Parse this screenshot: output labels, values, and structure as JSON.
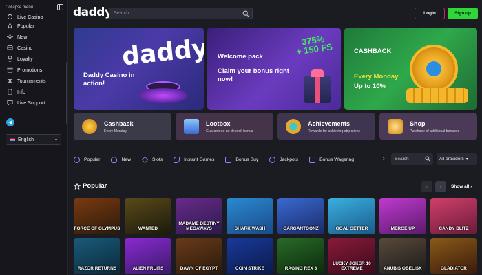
{
  "sidebar": {
    "collapse_label": "Collapse menu",
    "items": [
      {
        "label": "Live Casino"
      },
      {
        "label": "Popular"
      },
      {
        "label": "New"
      },
      {
        "label": "Casino"
      },
      {
        "label": "Loyalty"
      },
      {
        "label": "Promotions"
      },
      {
        "label": "Tournaments"
      },
      {
        "label": "Info"
      },
      {
        "label": "Live Support"
      }
    ],
    "language": "English"
  },
  "header": {
    "logo": "daddy",
    "search_placeholder": "Search...",
    "login_label": "Login",
    "signup_label": "Sign up"
  },
  "banners": {
    "b1": {
      "text": "Daddy Casino in action!",
      "art_text": "daddy"
    },
    "b2": {
      "title": "Welcome pack",
      "subtitle": "Claim your bonus right now!",
      "badge_pct": "375%",
      "badge_fs": "+ 150 FS"
    },
    "b3": {
      "title": "CASHBACK",
      "day": "Every Monday",
      "amount": "Up to 10%"
    }
  },
  "tiles": [
    {
      "title": "Cashback",
      "subtitle": "Every Monday",
      "color": "#f0a11f"
    },
    {
      "title": "Lootbox",
      "subtitle": "Guaranteed no deposit bonus",
      "color": "#5aa8ff"
    },
    {
      "title": "Achievements",
      "subtitle": "Rewards for achieving objectives",
      "color": "#e8a82a"
    },
    {
      "title": "Shop",
      "subtitle": "Purchase of additional bonuses",
      "color": "#f5b52a"
    }
  ],
  "categories": [
    {
      "label": "Popular",
      "color": "#a07bff"
    },
    {
      "label": "New",
      "color": "#a07bff"
    },
    {
      "label": "Slots",
      "color": "#a07bff"
    },
    {
      "label": "Instant Games",
      "color": "#a07bff"
    },
    {
      "label": "Bonus Buy",
      "color": "#a07bff"
    },
    {
      "label": "Jackpots",
      "color": "#a07bff"
    },
    {
      "label": "Bonus Wagering",
      "color": "#a07bff"
    }
  ],
  "filters": {
    "search_label": "Search",
    "providers_label": "All providers"
  },
  "popular": {
    "title": "Popular",
    "show_all": "Show all",
    "games": [
      {
        "name": "Force of Olympus",
        "color1": "#7a3a12",
        "color2": "#2a1a0a"
      },
      {
        "name": "Wanted",
        "color1": "#5a4a1a",
        "color2": "#1a1a0a"
      },
      {
        "name": "Madame Destiny Megaways",
        "color1": "#6a2a8a",
        "color2": "#2a1a4a"
      },
      {
        "name": "Shark Wash",
        "color1": "#2a8ad0",
        "color2": "#1a4a8a"
      },
      {
        "name": "Gargantoonz",
        "color1": "#3a6ad0",
        "color2": "#1a2a6a"
      },
      {
        "name": "Goal Getter",
        "color1": "#3ab0e0",
        "color2": "#1a5a8a"
      },
      {
        "name": "Merge Up",
        "color1": "#c03ad0",
        "color2": "#5a1a6a"
      },
      {
        "name": "Candy Blitz",
        "color1": "#d0406a",
        "color2": "#6a1a3a"
      },
      {
        "name": "Razor Returns",
        "color1": "#1a5a7a",
        "color2": "#0a2a3a"
      },
      {
        "name": "Alien Fruits",
        "color1": "#8a2ad0",
        "color2": "#3a1a6a"
      },
      {
        "name": "Dawn of Egypt",
        "color1": "#6a3a1a",
        "color2": "#2a1a0a"
      },
      {
        "name": "Coin Strike",
        "color1": "#1a3a9a",
        "color2": "#0a1a4a"
      },
      {
        "name": "Raging Rex 3",
        "color1": "#2a6a2a",
        "color2": "#0a2a0a"
      },
      {
        "name": "Lucky Joker 10 Extreme",
        "color1": "#8a1a3a",
        "color2": "#3a0a1a"
      },
      {
        "name": "Anubis Obelisk",
        "color1": "#5a4a3a",
        "color2": "#1a1a1a"
      },
      {
        "name": "Gladiator",
        "color1": "#8a5a1a",
        "color2": "#3a1a0a"
      }
    ]
  }
}
